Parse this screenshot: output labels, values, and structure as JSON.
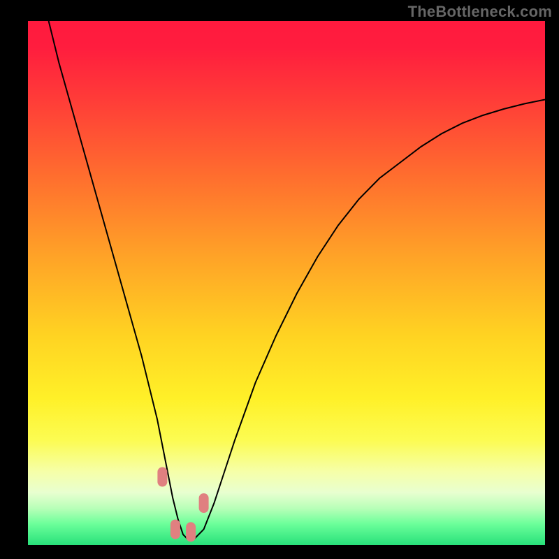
{
  "watermark": "TheBottleneck.com",
  "chart_data": {
    "type": "line",
    "title": "",
    "xlabel": "",
    "ylabel": "",
    "xlim": [
      0,
      100
    ],
    "ylim": [
      0,
      100
    ],
    "background_gradient": {
      "stops": [
        {
          "offset": 0.0,
          "color": "#ff1a3e"
        },
        {
          "offset": 0.05,
          "color": "#ff1d3e"
        },
        {
          "offset": 0.15,
          "color": "#ff3c38"
        },
        {
          "offset": 0.3,
          "color": "#ff6f2e"
        },
        {
          "offset": 0.45,
          "color": "#ffa327"
        },
        {
          "offset": 0.6,
          "color": "#ffd322"
        },
        {
          "offset": 0.72,
          "color": "#fff028"
        },
        {
          "offset": 0.8,
          "color": "#fcfc52"
        },
        {
          "offset": 0.86,
          "color": "#f6ffa8"
        },
        {
          "offset": 0.9,
          "color": "#e8ffd0"
        },
        {
          "offset": 0.93,
          "color": "#b8ffb8"
        },
        {
          "offset": 0.96,
          "color": "#6bff9a"
        },
        {
          "offset": 1.0,
          "color": "#28e07a"
        }
      ]
    },
    "series": [
      {
        "name": "bottleneck-curve",
        "stroke": "#000000",
        "stroke_width": 2,
        "x": [
          4,
          5,
          6,
          8,
          10,
          12,
          14,
          16,
          18,
          20,
          22,
          24,
          25,
          26,
          27,
          28,
          29,
          30,
          31,
          32,
          34,
          36,
          38,
          40,
          44,
          48,
          52,
          56,
          60,
          64,
          68,
          72,
          76,
          80,
          84,
          88,
          92,
          96,
          100
        ],
        "y": [
          100,
          96,
          92,
          85,
          78,
          71,
          64,
          57,
          50,
          43,
          36,
          28,
          24,
          19,
          14,
          9,
          5,
          2,
          1,
          1,
          3,
          8,
          14,
          20,
          31,
          40,
          48,
          55,
          61,
          66,
          70,
          73,
          76,
          78.5,
          80.5,
          82,
          83.2,
          84.2,
          85
        ]
      }
    ],
    "markers": [
      {
        "name": "marker-a",
        "x": 26.0,
        "y": 13.0,
        "color": "#e08080"
      },
      {
        "name": "marker-b",
        "x": 28.5,
        "y": 3.0,
        "color": "#e08080"
      },
      {
        "name": "marker-c",
        "x": 31.5,
        "y": 2.5,
        "color": "#e08080"
      },
      {
        "name": "marker-d",
        "x": 34.0,
        "y": 8.0,
        "color": "#e08080"
      }
    ]
  }
}
